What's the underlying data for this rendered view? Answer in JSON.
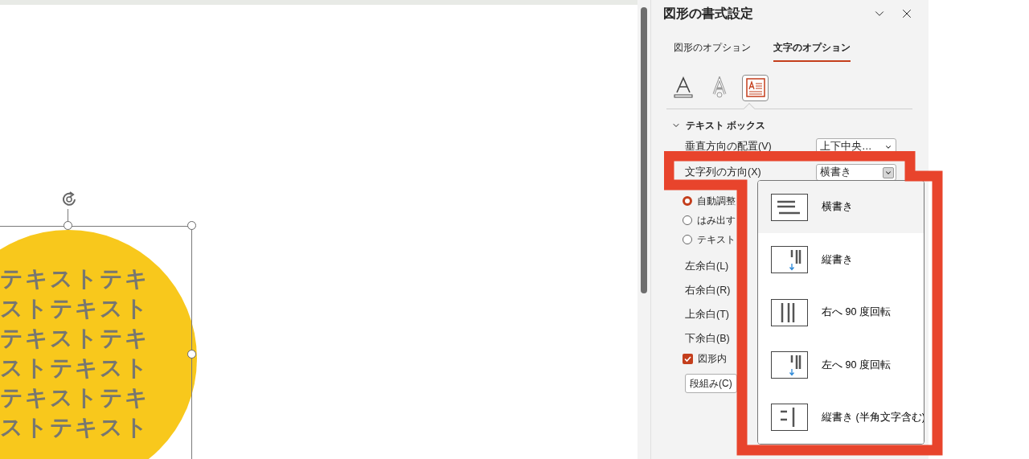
{
  "slide": {
    "shape_text_lines": [
      "テキストテキ",
      "ストテキスト",
      "テキストテキ",
      "ストテキスト",
      "テキストテキ",
      "ストテキスト"
    ]
  },
  "panel": {
    "title": "図形の書式設定",
    "tabs": [
      {
        "label": "図形のオプション",
        "selected": false
      },
      {
        "label": "文字のオプション",
        "selected": true
      }
    ],
    "icon_tabs": [
      {
        "kind": "fill",
        "selected": false
      },
      {
        "kind": "effects",
        "selected": false
      },
      {
        "kind": "textbox",
        "selected": true
      }
    ],
    "section": {
      "title": "テキスト ボックス",
      "expanded": true
    },
    "selects": [
      {
        "label": "垂直方向の配置(V)",
        "value": "上下中央…",
        "highlighted": false
      },
      {
        "label": "文字列の方向(X)",
        "value": "横書き",
        "highlighted": true
      }
    ],
    "radios": [
      {
        "label": "自動調整",
        "selected": true
      },
      {
        "label": "はみ出す",
        "selected": false
      },
      {
        "label": "テキスト",
        "selected": false
      }
    ],
    "margins": [
      "左余白(L)",
      "右余白(R)",
      "上余白(T)",
      "下余白(B)"
    ],
    "checkbox": {
      "label": "図形内",
      "checked": true
    },
    "button": "段組み(C)"
  },
  "dropdown": {
    "items": [
      {
        "kind": "horizontal",
        "label": "横書き",
        "selected": true
      },
      {
        "kind": "vertical",
        "label": "縦書き",
        "selected": false
      },
      {
        "kind": "rotate-right",
        "label": "右へ 90 度回転",
        "selected": false
      },
      {
        "kind": "rotate-left",
        "label": "左へ 90 度回転",
        "selected": false
      },
      {
        "kind": "stacked",
        "label": "縦書き (半角文字含む)",
        "selected": false
      }
    ]
  }
}
